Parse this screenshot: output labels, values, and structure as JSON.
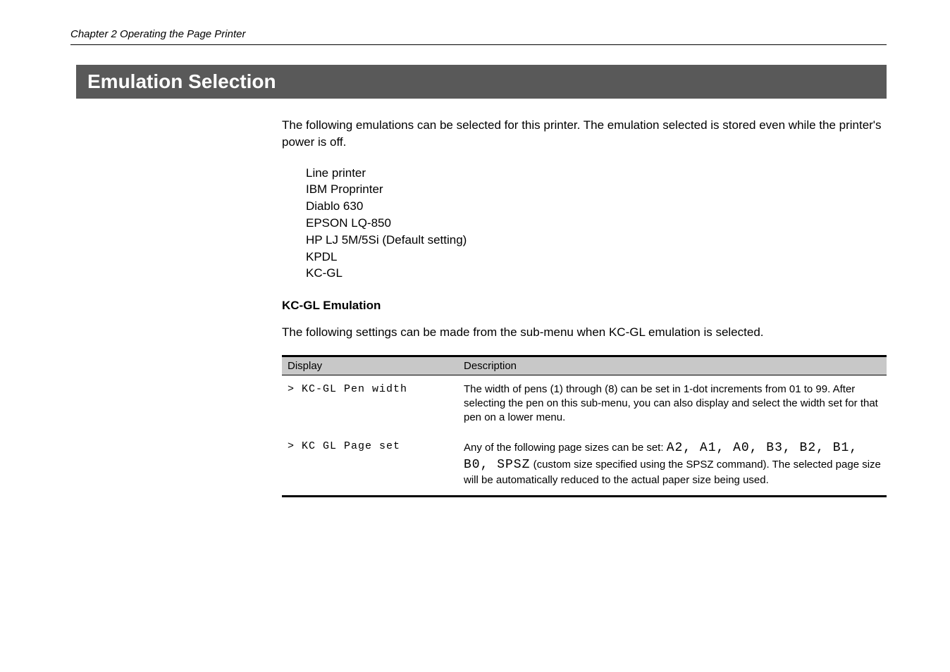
{
  "header": {
    "chapter_line": "Chapter 2  Operating the Page Printer"
  },
  "section": {
    "title": "Emulation Selection",
    "intro_para": "The following emulations can be selected for this printer. The emulation selected is stored even while the printer's power is off.",
    "emulations": [
      "Line printer",
      "IBM Proprinter",
      "Diablo 630",
      "EPSON LQ-850",
      "HP LJ 5M/5Si (Default setting)",
      "KPDL",
      "KC-GL"
    ],
    "sub_heading": "KC-GL Emulation",
    "sub_intro": "The following settings can be made from the sub-menu when KC-GL emulation is selected."
  },
  "table": {
    "headers": {
      "col1": "Display",
      "col2": "Description"
    },
    "rows": [
      {
        "display": "> KC-GL Pen width",
        "desc": "The width of pens (1) through (8) can be set in 1-dot increments from 01 to 99. After selecting the pen on this sub-menu, you can also display and select the width set for that pen on a lower menu."
      },
      {
        "display": "> KC GL Page set",
        "desc_prefix": "Any of the following page sizes can be set: ",
        "codes": "A2, A1, A0, B3, B2, B1, B0, SPSZ",
        "desc_suffix": " (custom size specified using the SPSZ command).  The selected page size will be automatically reduced to the actual paper size being used."
      }
    ]
  }
}
